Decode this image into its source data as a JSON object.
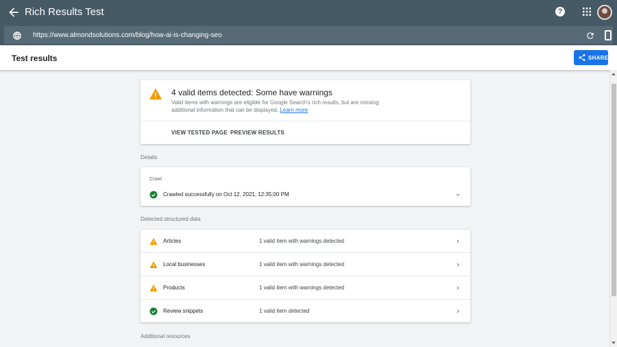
{
  "app": {
    "title": "Rich Results Test",
    "help_glyph": "?"
  },
  "url_bar": {
    "url": "https://www.almondsolutions.com/blog/how-ai-is-changing-seo"
  },
  "header": {
    "title": "Test results",
    "share_label": "SHARE"
  },
  "summary": {
    "headline": "4 valid items detected: Some have warnings",
    "description": "Valid items with warnings are eligible for Google Search's rich results, but are missing additional information that can be displayed.",
    "learn_more": "Learn more",
    "view_tested_page": "VIEW TESTED PAGE",
    "preview_results": "PREVIEW RESULTS"
  },
  "details": {
    "section_label": "Details",
    "crawl_label": "Crawl",
    "crawl_status": "Crawled successfully on Oct 12, 2021, 12:35:00 PM"
  },
  "structured_data": {
    "section_label": "Detected structured data",
    "items": [
      {
        "name": "Articles",
        "status": "1 valid item with warnings detected",
        "icon": "warning-icon"
      },
      {
        "name": "Local businesses",
        "status": "1 valid item with warnings detected",
        "icon": "warning-icon"
      },
      {
        "name": "Products",
        "status": "1 valid item with warnings detected",
        "icon": "warning-icon"
      },
      {
        "name": "Review snippets",
        "status": "1 valid item detected",
        "icon": "check-circle-icon"
      }
    ]
  },
  "additional": {
    "section_label": "Additional resources"
  },
  "colors": {
    "topbar": "#455a64",
    "accent": "#1a73e8",
    "warning": "#f29900",
    "success": "#188038"
  }
}
